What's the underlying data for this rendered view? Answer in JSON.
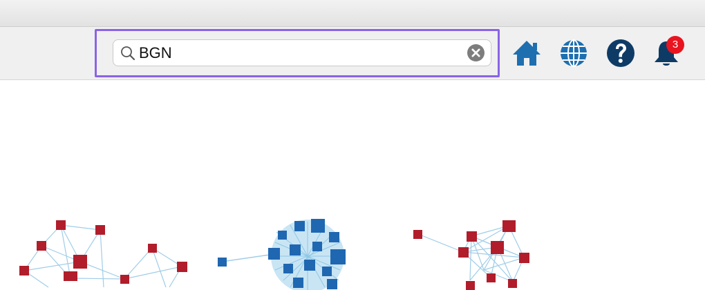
{
  "search": {
    "value": "BGN",
    "icon": "search-icon",
    "clear_icon": "clear-icon"
  },
  "toolbar": {
    "icons": [
      "home-icon",
      "globe-icon",
      "help-icon",
      "bell-icon"
    ],
    "notification_count": "3"
  },
  "colors": {
    "icon_blue": "#1e6fb0",
    "icon_navy": "#0d3b66",
    "node_red": "#b11d2b",
    "node_blue": "#1f67b1",
    "edge": "#9fcde8",
    "badge_red": "#e8141f",
    "highlight": "#8a63e6"
  },
  "graph": {
    "clusters": [
      "red-network-cluster",
      "blue-network-cluster",
      "red-network-cluster"
    ]
  }
}
